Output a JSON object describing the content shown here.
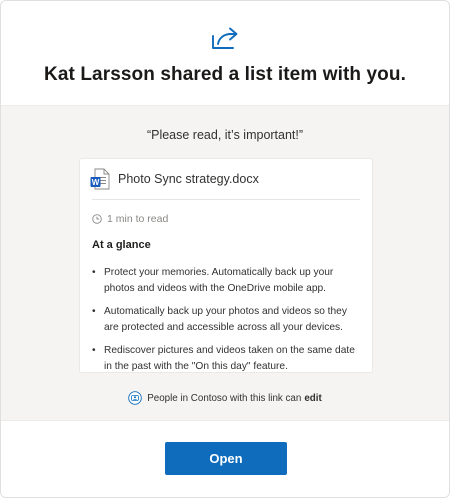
{
  "header": {
    "title": "Kat Larsson shared a list item with you.",
    "icon": "share-icon",
    "icon_color": "#0f6cbd"
  },
  "message": "“Please read, it’s important!”",
  "document": {
    "name": "Photo Sync strategy.docx",
    "icon": "word-document-icon",
    "icon_letter": "W",
    "read_time": "1 min to read",
    "glance_heading": "At a glance",
    "glance_items": [
      "Protect your memories. Automatically back up your photos and videos with the OneDrive mobile app.",
      "Automatically back up your photos and videos so they are protected and accessible across all your devices.",
      "Rediscover pictures and videos taken on the same date in the past with the \"On this day\" feature."
    ],
    "bullet": "•"
  },
  "permission": {
    "icon": "people-group-icon",
    "text": "People in Contoso with this link can",
    "level": "edit"
  },
  "footer": {
    "open_label": "Open",
    "accent_color": "#0f6cbd"
  }
}
